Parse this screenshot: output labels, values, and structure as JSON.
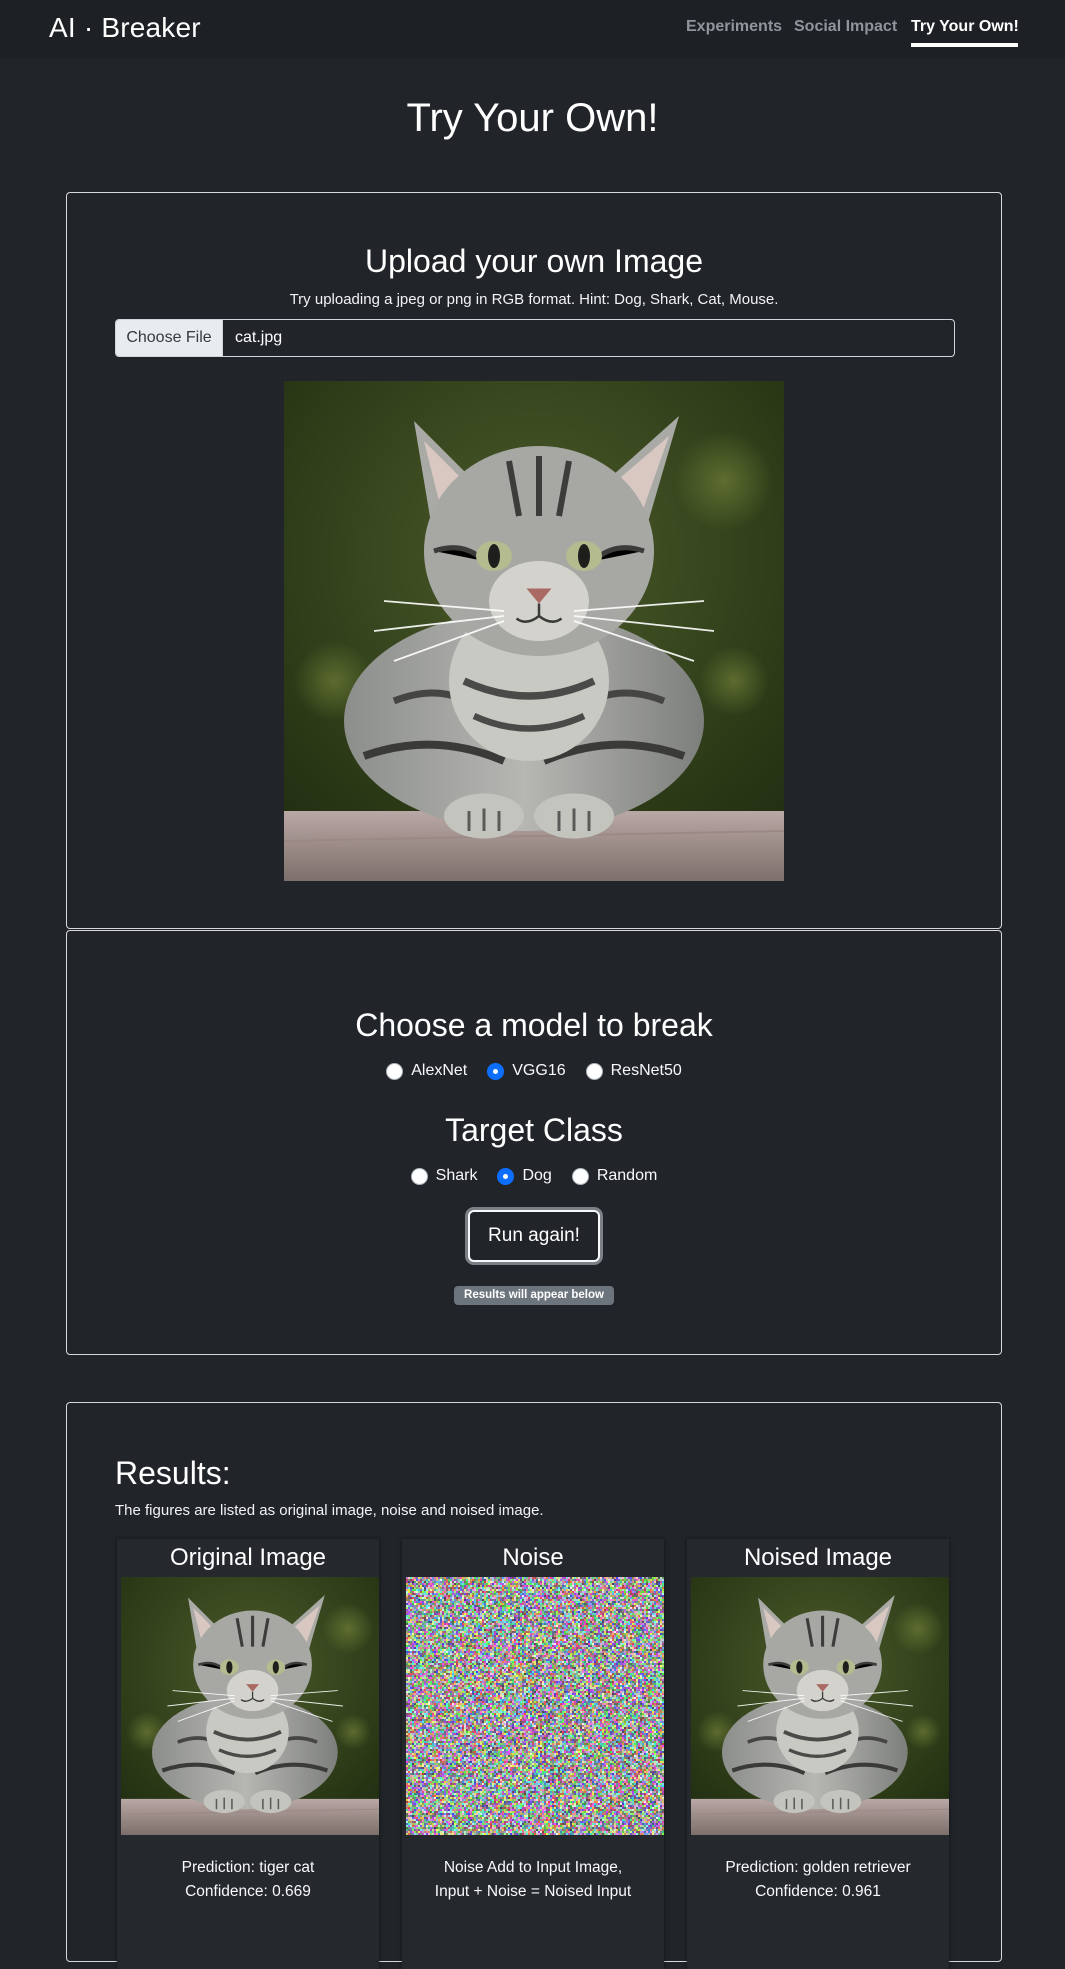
{
  "navbar": {
    "brand": "AI · Breaker",
    "links": [
      {
        "label": "Experiments",
        "active": false
      },
      {
        "label": "Social Impact",
        "active": false
      },
      {
        "label": "Try Your Own!",
        "active": true
      }
    ]
  },
  "page": {
    "title": "Try Your Own!"
  },
  "upload": {
    "title": "Upload your own Image",
    "hint": "Try uploading a jpeg or png in RGB format. Hint: Dog, Shark, Cat, Mouse.",
    "button_label": "Choose File",
    "file_name": "cat.jpg"
  },
  "model": {
    "title": "Choose a model to break",
    "options": [
      {
        "label": "AlexNet",
        "checked": false
      },
      {
        "label": "VGG16",
        "checked": true
      },
      {
        "label": "ResNet50",
        "checked": false
      }
    ],
    "target_title": "Target Class",
    "targets": [
      {
        "label": "Shark",
        "checked": false
      },
      {
        "label": "Dog",
        "checked": true
      },
      {
        "label": "Random",
        "checked": false
      }
    ],
    "run_label": "Run again!",
    "status": "Results will appear below"
  },
  "results": {
    "title": "Results:",
    "description": "The figures are listed as original image, noise and noised image.",
    "columns": [
      {
        "title": "Original Image",
        "line1": "Prediction: tiger cat",
        "line2": "Confidence: 0.669"
      },
      {
        "title": "Noise",
        "line1": "Noise Add to Input Image,",
        "line2": "Input + Noise = Noised Input"
      },
      {
        "title": "Noised Image",
        "line1": "Prediction: golden retriever",
        "line2": "Confidence: 0.961"
      }
    ]
  },
  "colors": {
    "background": "#212529",
    "accent": "#0d6efd",
    "badge": "#6c757d"
  }
}
